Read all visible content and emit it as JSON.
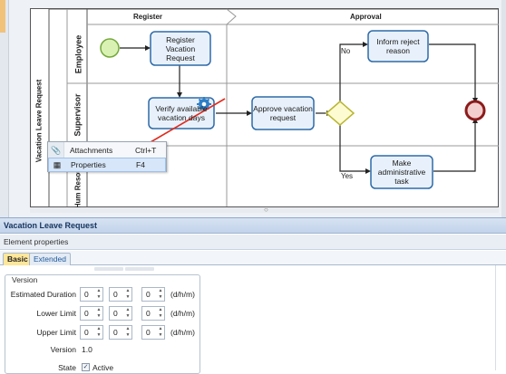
{
  "diagram": {
    "pool_name": "Vacation Leave Request",
    "phases": [
      "Register",
      "Approval"
    ],
    "lanes": [
      "Employee",
      "Supervisor",
      "Human Resources"
    ],
    "lane3_visible": "Hum Resour",
    "tasks": {
      "register": "Register Vacation Request",
      "verify": "Verify available vacation days",
      "approve": "Approve vacation request",
      "inform": "Inform reject reason",
      "administrative": "Make administrative task"
    },
    "flow_labels": {
      "no": "No",
      "yes": "Yes"
    }
  },
  "context_menu": {
    "items": [
      {
        "label": "Attachments",
        "shortcut": "Ctrl+T",
        "icon": "paperclip-icon"
      },
      {
        "label": "Properties",
        "shortcut": "F4",
        "icon": "properties-icon"
      }
    ]
  },
  "panel": {
    "title": "Vacation Leave Request",
    "subheader": "Element properties",
    "tabs": [
      "Basic",
      "Extended"
    ],
    "active_tab": "Basic",
    "section_title": "Version",
    "fields": {
      "estimated_duration": {
        "label": "Estimated Duration",
        "values": [
          "0",
          "0",
          "0"
        ],
        "unit": "(d/h/m)"
      },
      "lower_limit": {
        "label": "Lower Limit",
        "values": [
          "0",
          "0",
          "0"
        ],
        "unit": "(d/h/m)"
      },
      "upper_limit": {
        "label": "Upper Limit",
        "values": [
          "0",
          "0",
          "0"
        ],
        "unit": "(d/h/m)"
      },
      "version": {
        "label": "Version",
        "value": "1.0"
      },
      "state": {
        "label": "State",
        "value": "Active",
        "checked": true
      }
    }
  },
  "colors": {
    "start_fill": "#d9f2b4",
    "start_stroke": "#74a83a",
    "end_fill": "#f4cfcf",
    "end_stroke": "#8c1b1b",
    "gateway_fill": "#fdfbd2",
    "gateway_stroke": "#b9b531",
    "task_fill": "#e8f1fb",
    "task_stroke": "#2f6aa8",
    "annotation_arrow": "#e02a1c",
    "panel_title_text": "#15335e",
    "active_tab": "#ffe79a"
  }
}
